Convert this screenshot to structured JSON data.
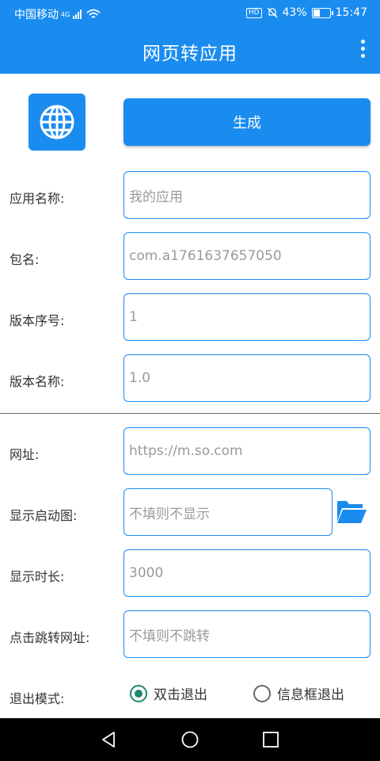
{
  "status_bar": {
    "carrier": "中国移动",
    "network": "4G",
    "hd": "HD",
    "battery_text": "43%",
    "battery_level": 0.43,
    "time": "15:47"
  },
  "app_bar": {
    "title": "网页转应用",
    "menu_icon": "more-vert-icon"
  },
  "header": {
    "app_icon": "globe-icon",
    "generate_label": "生成"
  },
  "fields": {
    "app_name": {
      "label": "应用名称:",
      "placeholder": "我的应用"
    },
    "package": {
      "label": "包名:",
      "placeholder": "com.a1761637657050"
    },
    "version_code": {
      "label": "版本序号:",
      "placeholder": "1"
    },
    "version_name": {
      "label": "版本名称:",
      "placeholder": "1.0"
    },
    "url": {
      "label": "网址:",
      "placeholder": "https://m.so.com"
    },
    "splash": {
      "label": "显示启动图:",
      "placeholder": "不填则不显示",
      "browse_icon": "folder-open-icon"
    },
    "duration": {
      "label": "显示时长:",
      "placeholder": "3000"
    },
    "click_url": {
      "label": "点击跳转网址:",
      "placeholder": "不填则不跳转"
    }
  },
  "exit_mode": {
    "label": "退出模式:",
    "options": [
      "双击退出",
      "信息框退出"
    ],
    "selected": "双击退出"
  },
  "nav_bar": {
    "icons": [
      "back-icon",
      "home-icon",
      "recents-icon"
    ]
  },
  "colors": {
    "primary": "#1a8cf0",
    "radio_selected": "#1e8a6e"
  }
}
